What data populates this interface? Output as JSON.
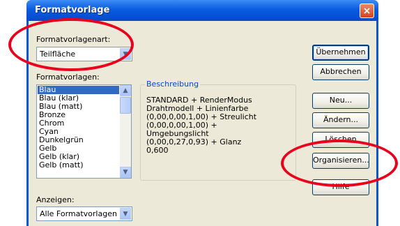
{
  "window": {
    "title": "Formatvorlage",
    "close_glyph": "×"
  },
  "type_section": {
    "label": "Formatvorlagenart:",
    "selected": "Teilfläche"
  },
  "styles_section": {
    "label": "Formatvorlagen:",
    "items": [
      "Blau",
      "Blau (klar)",
      "Blau (matt)",
      "Bronze",
      "Chrom",
      "Cyan",
      "Dunkelgrün",
      "Gelb",
      "Gelb (klar)",
      "Gelb (matt)"
    ],
    "selected_index": 0
  },
  "description": {
    "title": "Beschreibung",
    "text": "STANDARD + RenderModus Drahtmodell + Linienfarbe (0,00,0,00,1,00) + Streulicht (0,00,0,00,1,00) + Umgebungslicht (0,00,0,27,0,93) + Glanz 0,600"
  },
  "show_section": {
    "label": "Anzeigen:",
    "selected": "Alle Formatvorlagen"
  },
  "buttons": {
    "apply": "Übernehmen",
    "cancel": "Abbrechen",
    "new": "Neu...",
    "change": "Ändern...",
    "delete": "Löschen",
    "organize": "Organisieren...",
    "help": "Hilfe"
  },
  "annotation_color": "#e8001c"
}
